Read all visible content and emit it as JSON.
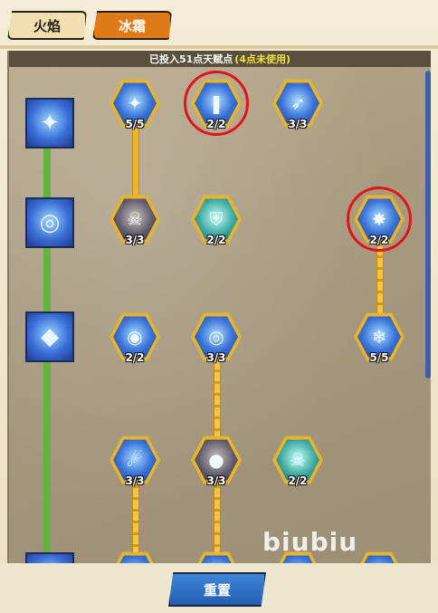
{
  "tabs": {
    "fire": "火焰",
    "ice": "冰霜"
  },
  "points": {
    "invested": "已投入51点天赋点",
    "unused": "(4点未使用)"
  },
  "rows": [
    {
      "icon": "ice-staff-icon"
    },
    {
      "icon": "ice-vortex-icon"
    },
    {
      "icon": "ice-crystal-icon"
    },
    {
      "icon": "ice-spike-icon"
    }
  ],
  "talents": [
    {
      "name": "ice-staff",
      "level": "5/5"
    },
    {
      "name": "ice-wall",
      "level": "2/2"
    },
    {
      "name": "ice-lance",
      "level": "3/3"
    },
    {
      "name": "frost-skeleton",
      "level": "3/3"
    },
    {
      "name": "ice-armor",
      "level": "2/2"
    },
    {
      "name": "ice-shatter",
      "level": "2/2"
    },
    {
      "name": "frost-orb",
      "level": "2/2"
    },
    {
      "name": "ice-vortex",
      "level": "3/3"
    },
    {
      "name": "snowflake",
      "level": "5/5"
    },
    {
      "name": "ice-comet",
      "level": "3/3"
    },
    {
      "name": "frost-boulder",
      "level": "3/3"
    },
    {
      "name": "frost-skull",
      "level": "2/2"
    }
  ],
  "watermark": "biubiu",
  "reset_label": "重置"
}
